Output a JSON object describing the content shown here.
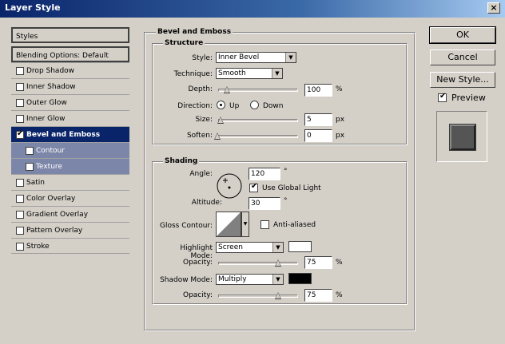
{
  "window": {
    "title": "Layer Style",
    "close_label": "×"
  },
  "left_panel": {
    "styles_label": "Styles",
    "blending_label": "Blending Options: Default",
    "items": [
      {
        "label": "Drop Shadow",
        "checked": false
      },
      {
        "label": "Inner Shadow",
        "checked": false
      },
      {
        "label": "Outer Glow",
        "checked": false
      },
      {
        "label": "Inner Glow",
        "checked": false
      },
      {
        "label": "Bevel and Emboss",
        "checked": true
      },
      {
        "label": "Contour",
        "checked": false
      },
      {
        "label": "Texture",
        "checked": false
      },
      {
        "label": "Satin",
        "checked": false
      },
      {
        "label": "Color Overlay",
        "checked": false
      },
      {
        "label": "Gradient Overlay",
        "checked": false
      },
      {
        "label": "Pattern Overlay",
        "checked": false
      },
      {
        "label": "Stroke",
        "checked": false
      }
    ]
  },
  "bevel": {
    "title": "Bevel and Emboss",
    "structure": {
      "title": "Structure",
      "style_label": "Style:",
      "style_value": "Inner Bevel",
      "technique_label": "Technique:",
      "technique_value": "Smooth",
      "depth_label": "Depth:",
      "depth_value": "100",
      "depth_unit": "%",
      "direction_label": "Direction:",
      "up_label": "Up",
      "down_label": "Down",
      "direction_value": "Up",
      "size_label": "Size:",
      "size_value": "5",
      "size_unit": "px",
      "soften_label": "Soften:",
      "soften_value": "0",
      "soften_unit": "px"
    },
    "shading": {
      "title": "Shading",
      "angle_label": "Angle:",
      "angle_value": "120",
      "angle_unit": "°",
      "global_light_label": "Use Global Light",
      "global_light_checked": true,
      "altitude_label": "Altitude:",
      "altitude_value": "30",
      "altitude_unit": "°",
      "gloss_label": "Gloss Contour:",
      "anti_aliased_label": "Anti-aliased",
      "anti_aliased_checked": false,
      "highlight_mode_label": "Highlight Mode:",
      "highlight_mode_value": "Screen",
      "highlight_color": "#ffffff",
      "highlight_opacity_label": "Opacity:",
      "highlight_opacity_value": "75",
      "highlight_opacity_unit": "%",
      "shadow_mode_label": "Shadow Mode:",
      "shadow_mode_value": "Multiply",
      "shadow_color": "#000000",
      "shadow_opacity_label": "Opacity:",
      "shadow_opacity_value": "75",
      "shadow_opacity_unit": "%"
    }
  },
  "buttons": {
    "ok": "OK",
    "cancel": "Cancel",
    "new_style": "New Style...",
    "preview_label": "Preview",
    "preview_checked": true
  },
  "colors": {
    "selection": "#0a246a",
    "sub_selection": "#7c86a8",
    "face": "#d4d0c8"
  }
}
